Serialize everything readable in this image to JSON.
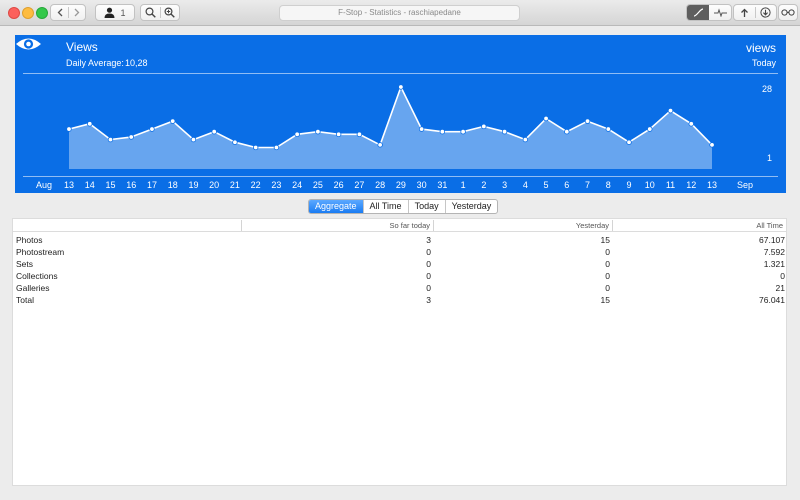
{
  "window": {
    "title": "F-Stop - Statistics - raschiapedane"
  },
  "toolbar": {
    "user_count": "1"
  },
  "chart_header": {
    "title": "Views",
    "daily_average_label": "Daily Average:",
    "daily_average_value": "10,28",
    "metric": "views",
    "period": "Today"
  },
  "chart_data": {
    "type": "area",
    "x": [
      "13",
      "14",
      "15",
      "16",
      "17",
      "18",
      "19",
      "20",
      "21",
      "22",
      "23",
      "24",
      "25",
      "26",
      "27",
      "28",
      "29",
      "30",
      "31",
      "1",
      "2",
      "3",
      "4",
      "5",
      "6",
      "7",
      "8",
      "9",
      "10",
      "11",
      "12",
      "13"
    ],
    "y_tick_labels": [
      "28",
      "1"
    ],
    "month_labels": [
      "Aug",
      "Sep"
    ],
    "series": [
      {
        "values": [
          12,
          14,
          8,
          9,
          12,
          15,
          8,
          11,
          7,
          5,
          5,
          10,
          11,
          10,
          10,
          6,
          28,
          12,
          11,
          11,
          13,
          11,
          8,
          16,
          11,
          15,
          12,
          7,
          12,
          19,
          14,
          6
        ]
      }
    ],
    "ylim": [
      1,
      28
    ],
    "grid": false,
    "colors": {
      "background": "#0a6ee6",
      "line": "#ffffff"
    }
  },
  "tabs": [
    {
      "label": "Aggregate",
      "selected": true
    },
    {
      "label": "All Time",
      "selected": false
    },
    {
      "label": "Today",
      "selected": false
    },
    {
      "label": "Yesterday",
      "selected": false
    }
  ],
  "table": {
    "columns": [
      "So far today",
      "Yesterday",
      "All Time"
    ],
    "rows": [
      {
        "name": "Photos",
        "today": "3",
        "yesterday": "15",
        "all_time": "67.107"
      },
      {
        "name": "Photostream",
        "today": "0",
        "yesterday": "0",
        "all_time": "7.592"
      },
      {
        "name": "Sets",
        "today": "0",
        "yesterday": "0",
        "all_time": "1.321"
      },
      {
        "name": "Collections",
        "today": "0",
        "yesterday": "0",
        "all_time": "0"
      },
      {
        "name": "Galleries",
        "today": "0",
        "yesterday": "0",
        "all_time": "21"
      },
      {
        "name": "Total",
        "today": "3",
        "yesterday": "15",
        "all_time": "76.041"
      }
    ]
  }
}
